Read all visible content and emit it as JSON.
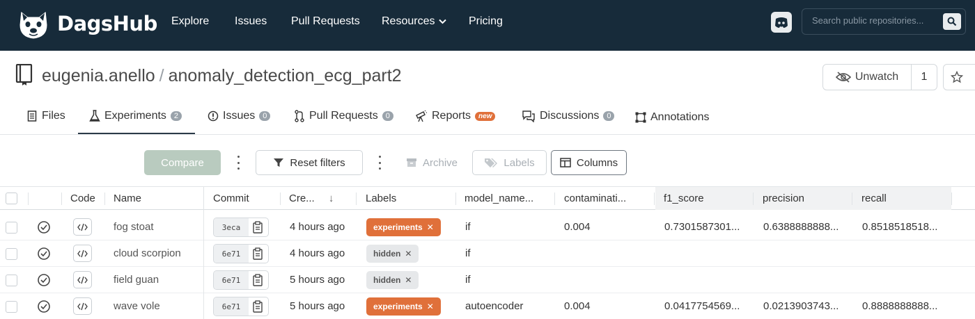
{
  "brand": {
    "name": "DagsHub",
    "nav_bg": "#172b3a",
    "accent": "#e0703a"
  },
  "nav": {
    "explore": "Explore",
    "issues": "Issues",
    "pull_requests": "Pull Requests",
    "resources": "Resources",
    "pricing": "Pricing",
    "search_placeholder": "Search public repositories..."
  },
  "repo": {
    "owner": "eugenia.anello",
    "name": "anomaly_detection_ecg_part2",
    "separator": "/"
  },
  "repo_actions": {
    "unwatch_label": "Unwatch",
    "watch_count": "1"
  },
  "tabs": [
    {
      "label": "Files",
      "icon": "file-icon"
    },
    {
      "label": "Experiments",
      "count": "2",
      "icon": "flask-icon",
      "active": true
    },
    {
      "label": "Issues",
      "count": "0",
      "icon": "alert-circle-icon"
    },
    {
      "label": "Pull Requests",
      "count": "0",
      "icon": "pull-request-icon"
    },
    {
      "label": "Reports",
      "badge": "new",
      "icon": "telescope-icon"
    },
    {
      "label": "Discussions",
      "count": "0",
      "icon": "chat-icon"
    },
    {
      "label": "Annotations",
      "icon": "bounding-box-icon"
    }
  ],
  "toolbar": {
    "compare": "Compare",
    "reset_filters": "Reset filters",
    "archive": "Archive",
    "labels": "Labels",
    "columns": "Columns"
  },
  "table": {
    "headers": {
      "code": "Code",
      "name": "Name",
      "commit": "Commit",
      "created": "Cre...",
      "sort_indicator": "↓",
      "labels": "Labels",
      "model_name": "model_name...",
      "contamination": "contaminati...",
      "f1_score": "f1_score",
      "precision": "precision",
      "recall": "recall"
    },
    "rows": [
      {
        "name": "fog stoat",
        "commit": "3eca",
        "created": "4 hours ago",
        "label": "experiments",
        "model_name": "if",
        "contamination": "0.004",
        "f1_score": "0.7301587301...",
        "precision": "0.6388888888...",
        "recall": "0.8518518518..."
      },
      {
        "name": "cloud scorpion",
        "commit": "6e71",
        "created": "4 hours ago",
        "label": "hidden",
        "model_name": "if",
        "contamination": "",
        "f1_score": "",
        "precision": "",
        "recall": ""
      },
      {
        "name": "field guan",
        "commit": "6e71",
        "created": "5 hours ago",
        "label": "hidden",
        "model_name": "if",
        "contamination": "",
        "f1_score": "",
        "precision": "",
        "recall": ""
      },
      {
        "name": "wave vole",
        "commit": "6e71",
        "created": "5 hours ago",
        "label": "experiments",
        "model_name": "autoencoder",
        "contamination": "0.004",
        "f1_score": "0.0417754569...",
        "precision": "0.0213903743...",
        "recall": "0.8888888888..."
      }
    ]
  }
}
